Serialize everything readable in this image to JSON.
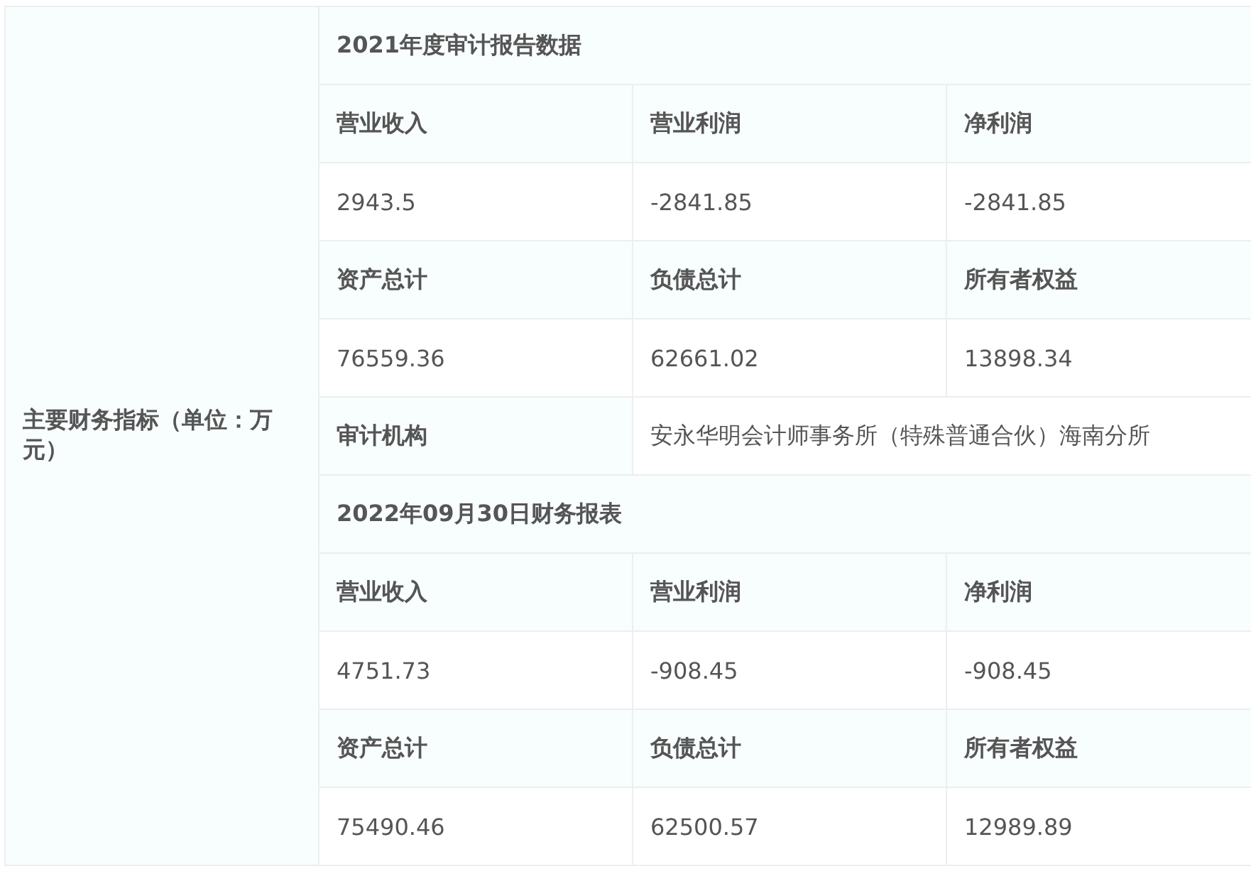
{
  "label": "主要财务指标（单位：万元）",
  "rows": [
    {
      "kind": "title",
      "cells": [
        "2021年度审计报告数据"
      ]
    },
    {
      "kind": "header",
      "cells": [
        "营业收入",
        "营业利润",
        "净利润"
      ]
    },
    {
      "kind": "values",
      "cells": [
        "2943.5",
        "-2841.85",
        "-2841.85"
      ]
    },
    {
      "kind": "header",
      "cells": [
        "资产总计",
        "负债总计",
        "所有者权益"
      ]
    },
    {
      "kind": "values",
      "cells": [
        "76559.36",
        "62661.02",
        "13898.34"
      ]
    },
    {
      "kind": "pair",
      "cells": [
        "审计机构",
        "安永华明会计师事务所（特殊普通合伙）海南分所"
      ]
    },
    {
      "kind": "title",
      "cells": [
        "2022年09月30日财务报表"
      ]
    },
    {
      "kind": "header",
      "cells": [
        "营业收入",
        "营业利润",
        "净利润"
      ]
    },
    {
      "kind": "values",
      "cells": [
        "4751.73",
        "-908.45",
        "-908.45"
      ]
    },
    {
      "kind": "header",
      "cells": [
        "资产总计",
        "负债总计",
        "所有者权益"
      ]
    },
    {
      "kind": "values",
      "cells": [
        "75490.46",
        "62500.57",
        "12989.89"
      ]
    }
  ]
}
